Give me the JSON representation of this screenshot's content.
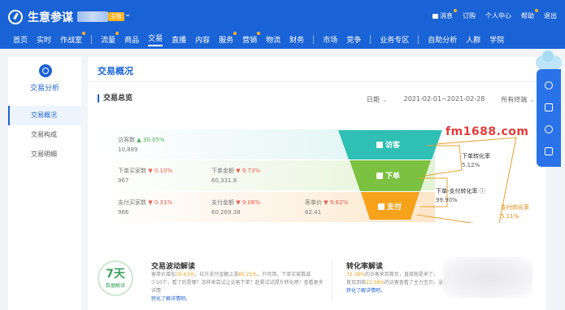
{
  "header": {
    "app_title": "生意参谋",
    "shop_badge": "主账",
    "right_links": [
      "消息",
      "订购",
      "个人中心",
      "帮助",
      "退出"
    ]
  },
  "nav": {
    "items": [
      "首页",
      "实时",
      "作战室",
      "流量",
      "商品",
      "交易",
      "直播",
      "内容",
      "服务",
      "营销",
      "物流",
      "财务",
      "市场",
      "竞争",
      "业务专区",
      "自助分析",
      "人群",
      "学院"
    ],
    "active": "交易"
  },
  "sidebar": {
    "title": "交易分析",
    "items": [
      "交易概况",
      "交易构成",
      "交易明细"
    ],
    "active_index": 0
  },
  "main": {
    "page_title": "交易概况",
    "section_title": "交易总览",
    "date_label": "日期",
    "date_range": "2021-02-01~2021-02-28",
    "terminal": "所有终端"
  },
  "funnel": {
    "stages": [
      {
        "label": "访客",
        "color": "#2fbfb4"
      },
      {
        "label": "下单",
        "color": "#7cc142"
      },
      {
        "label": "支付",
        "color": "#f7a21b"
      }
    ],
    "metrics": [
      {
        "name": "访客数",
        "change": "30.05%",
        "dir": "up",
        "value": "10,889"
      },
      {
        "name": "下单买家数",
        "change": "0.10%",
        "dir": "down",
        "value": "967"
      },
      {
        "name": "下单金额",
        "change": "9.73%",
        "dir": "down",
        "value": "60,331.8"
      },
      {
        "name": "支付买家数",
        "change": "0.31%",
        "dir": "down",
        "value": "966"
      },
      {
        "name": "支付金额",
        "change": "9.06%",
        "dir": "down",
        "value": "60,269.38"
      },
      {
        "name": "客单价",
        "change": "9.62%",
        "dir": "down",
        "value": "62.41"
      }
    ],
    "rates": [
      {
        "name": "下单转化率",
        "value": "5.12%"
      },
      {
        "name": "下单-支付转化率",
        "value": "99.90%"
      },
      {
        "name": "支付转化率",
        "value": "5.11%"
      }
    ]
  },
  "watermark": "fm1688.com",
  "bottom": {
    "days_num": "7天",
    "days_label": "数据解读",
    "card1_title": "交易波动解读",
    "card1_line1_a": "客单价增加",
    "card1_line1_hl": "16.63元",
    "card1_line1_b": "，拉升支付金额上涨",
    "card1_line1_hl2": "85.21%",
    "card1_line1_c": "，只可惜，下单买家数减",
    "card1_line2": "少10个，看了后是哪？怎样来尝试让访客下单？赶紧试试提升转化吧！查看更多详情",
    "card1_line3": "转化了解详情吧。",
    "card2_title": "转化率解读",
    "card2_line1_hl": "72.38%",
    "card2_line1": "的访客来到首页，直接就是来了，",
    "card2_line2_a": "首页到商",
    "card2_line2_hl": "22.38%",
    "card2_line2_b": "的访客查看了主力宝贝，没有",
    "card2_line3": "转化了解详情吧。"
  }
}
